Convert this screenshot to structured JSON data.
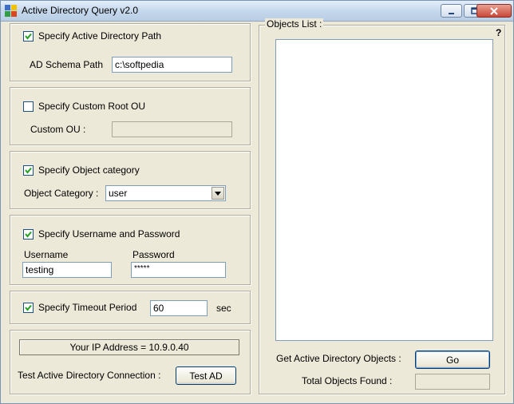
{
  "window": {
    "title": "Active Directory Query v2.0",
    "controls": {
      "minimize": "minimize-icon",
      "maximize": "maximize-icon",
      "close": "close-icon"
    }
  },
  "path_group": {
    "checkbox_label": "Specify Active Directory Path",
    "checked": true,
    "schema_label": "AD Schema Path",
    "schema_value": "c:\\softpedia"
  },
  "root_ou_group": {
    "checkbox_label": "Specify Custom Root OU",
    "checked": false,
    "ou_label": "Custom OU :",
    "ou_value": ""
  },
  "category_group": {
    "checkbox_label": "Specify Object category",
    "checked": true,
    "category_label": "Object Category :",
    "category_value": "user"
  },
  "credentials_group": {
    "checkbox_label": "Specify Username and Password",
    "checked": true,
    "username_label": "Username",
    "username_value": "testing",
    "password_label": "Password",
    "password_value": "*****"
  },
  "timeout_group": {
    "checkbox_label": "Specify Timeout Period",
    "checked": true,
    "timeout_value": "60",
    "unit_label": "sec"
  },
  "connection_group": {
    "ip_text": "Your IP Address = 10.9.0.40",
    "test_label": "Test Active Directory Connection :",
    "test_button": "Test AD"
  },
  "objects_panel": {
    "title": "Objects List :",
    "help": "?",
    "get_label": "Get Active Directory Objects :",
    "go_button": "Go",
    "total_label": "Total Objects Found :",
    "total_value": ""
  },
  "colors": {
    "title_bar": "#c6d8ec",
    "dialog_bg": "#ece9d8",
    "close_button": "#c9483a"
  }
}
